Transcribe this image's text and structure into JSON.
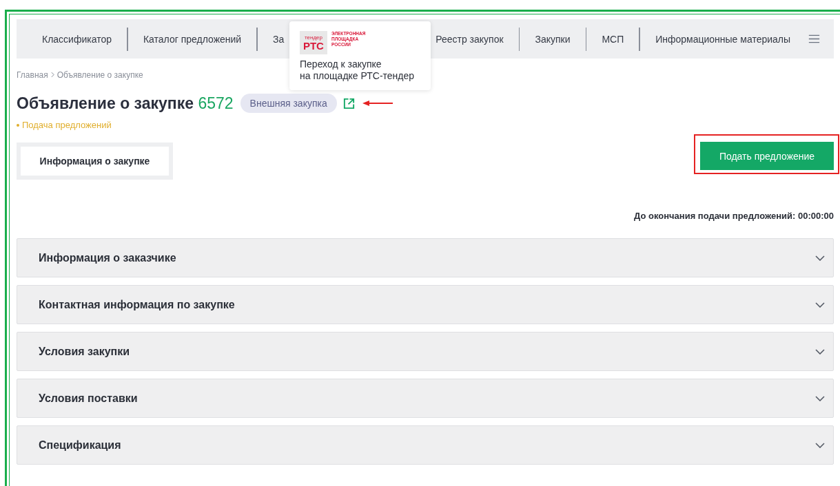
{
  "nav": {
    "items": [
      {
        "label": "Классификатор"
      },
      {
        "label": "Каталог предложений"
      },
      {
        "label": "За"
      },
      {
        "label": "Реестр закупок"
      },
      {
        "label": "Закупки"
      },
      {
        "label": "МСП"
      },
      {
        "label": "Информационные материалы"
      }
    ]
  },
  "tooltip": {
    "logo_small": "тендер",
    "logo_main": "РТС",
    "logo_caption": [
      "ЭЛЕКТРОННАЯ",
      "ПЛОЩАДКА",
      "РОССИИ"
    ],
    "lines": [
      "Переход к закупке",
      "на площадке РТС-тендер"
    ]
  },
  "breadcrumbs": [
    "Главная",
    "Объявление о закупке"
  ],
  "title": {
    "text": "Объявление о закупке",
    "number": "6572",
    "badge": "Внешняя закупка"
  },
  "status": "Подача предложений",
  "tabs": [
    {
      "label": "Информация о закупке",
      "selected": true
    }
  ],
  "submit_button": "Подать предложение",
  "deadline": "До окончания подачи предложений: 00:00:00",
  "sections": [
    {
      "title": "Информация о заказчике",
      "expanded": false
    },
    {
      "title": "Контактная информация по закупке",
      "expanded": false
    },
    {
      "title": "Условия закупки",
      "expanded": false
    },
    {
      "title": "Условия поставки",
      "expanded": false
    },
    {
      "title": "Спецификация",
      "expanded": false
    }
  ]
}
